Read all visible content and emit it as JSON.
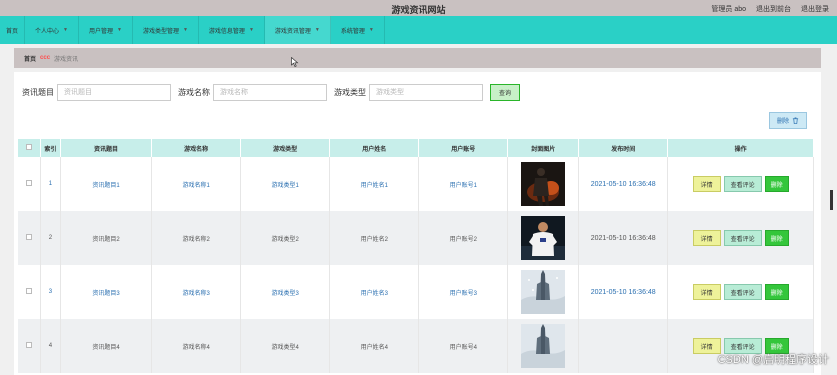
{
  "header": {
    "site_title": "游戏资讯网站",
    "admin_label": "管理员 abo",
    "goto_front": "退出到前台",
    "logout": "退出登录"
  },
  "nav": {
    "home": "首页",
    "items": [
      {
        "label": "个人中心"
      },
      {
        "label": "用户管理"
      },
      {
        "label": "游戏类型管理"
      },
      {
        "label": "游戏信息管理"
      },
      {
        "label": "游戏资讯管理"
      },
      {
        "label": "系统管理"
      }
    ],
    "active_index": 4
  },
  "breadcrumb": {
    "home": "首页",
    "separator": "ccc",
    "current": "游戏资讯"
  },
  "search": {
    "title_label": "资讯题目",
    "title_placeholder": "资讯题目",
    "name_label": "游戏名称",
    "name_placeholder": "游戏名称",
    "type_label": "游戏类型",
    "type_placeholder": "游戏类型",
    "query_label": "查询"
  },
  "toolbar": {
    "delete_label": "删除",
    "delete_icon": "trash-icon"
  },
  "table": {
    "headers": [
      "",
      "索引",
      "资讯题目",
      "游戏名称",
      "游戏类型",
      "用户姓名",
      "用户账号",
      "封面图片",
      "发布时间",
      "操作"
    ],
    "rows": [
      {
        "index": "1",
        "title": "资讯题目1",
        "game": "游戏名称1",
        "type": "游戏类型1",
        "username": "用户姓名1",
        "account": "用户账号1",
        "date": "2021-05-10 16:36:48",
        "cover": "game-character-dark-fire"
      },
      {
        "index": "2",
        "title": "资讯题目2",
        "game": "游戏名称2",
        "type": "游戏类型2",
        "username": "用户姓名2",
        "account": "用户账号2",
        "date": "2021-05-10 16:36:48",
        "cover": "football-player-white-jersey"
      },
      {
        "index": "3",
        "title": "资讯题目3",
        "game": "游戏名称3",
        "type": "游戏类型3",
        "username": "用户姓名3",
        "account": "用户账号3",
        "date": "2021-05-10 16:36:48",
        "cover": "snowy-tower-landscape"
      },
      {
        "index": "4",
        "title": "资讯题目4",
        "game": "游戏名称4",
        "type": "游戏类型4",
        "username": "用户姓名4",
        "account": "用户账号4",
        "date": "",
        "cover": "snowy-tower-landscape"
      }
    ],
    "actions": {
      "detail": "详情",
      "comments": "查看评论",
      "delete": "删除"
    }
  },
  "watermark": "CSDN @启明程序设计",
  "colors": {
    "nav_bg": "#2ad0c6",
    "header_bg": "#c9c1c1",
    "table_header_bg": "#c7eeea",
    "delete_btn": "#34c63b",
    "detail_btn": "#eef29a",
    "comment_btn": "#b8ecd6",
    "link": "#2a6fb0"
  }
}
